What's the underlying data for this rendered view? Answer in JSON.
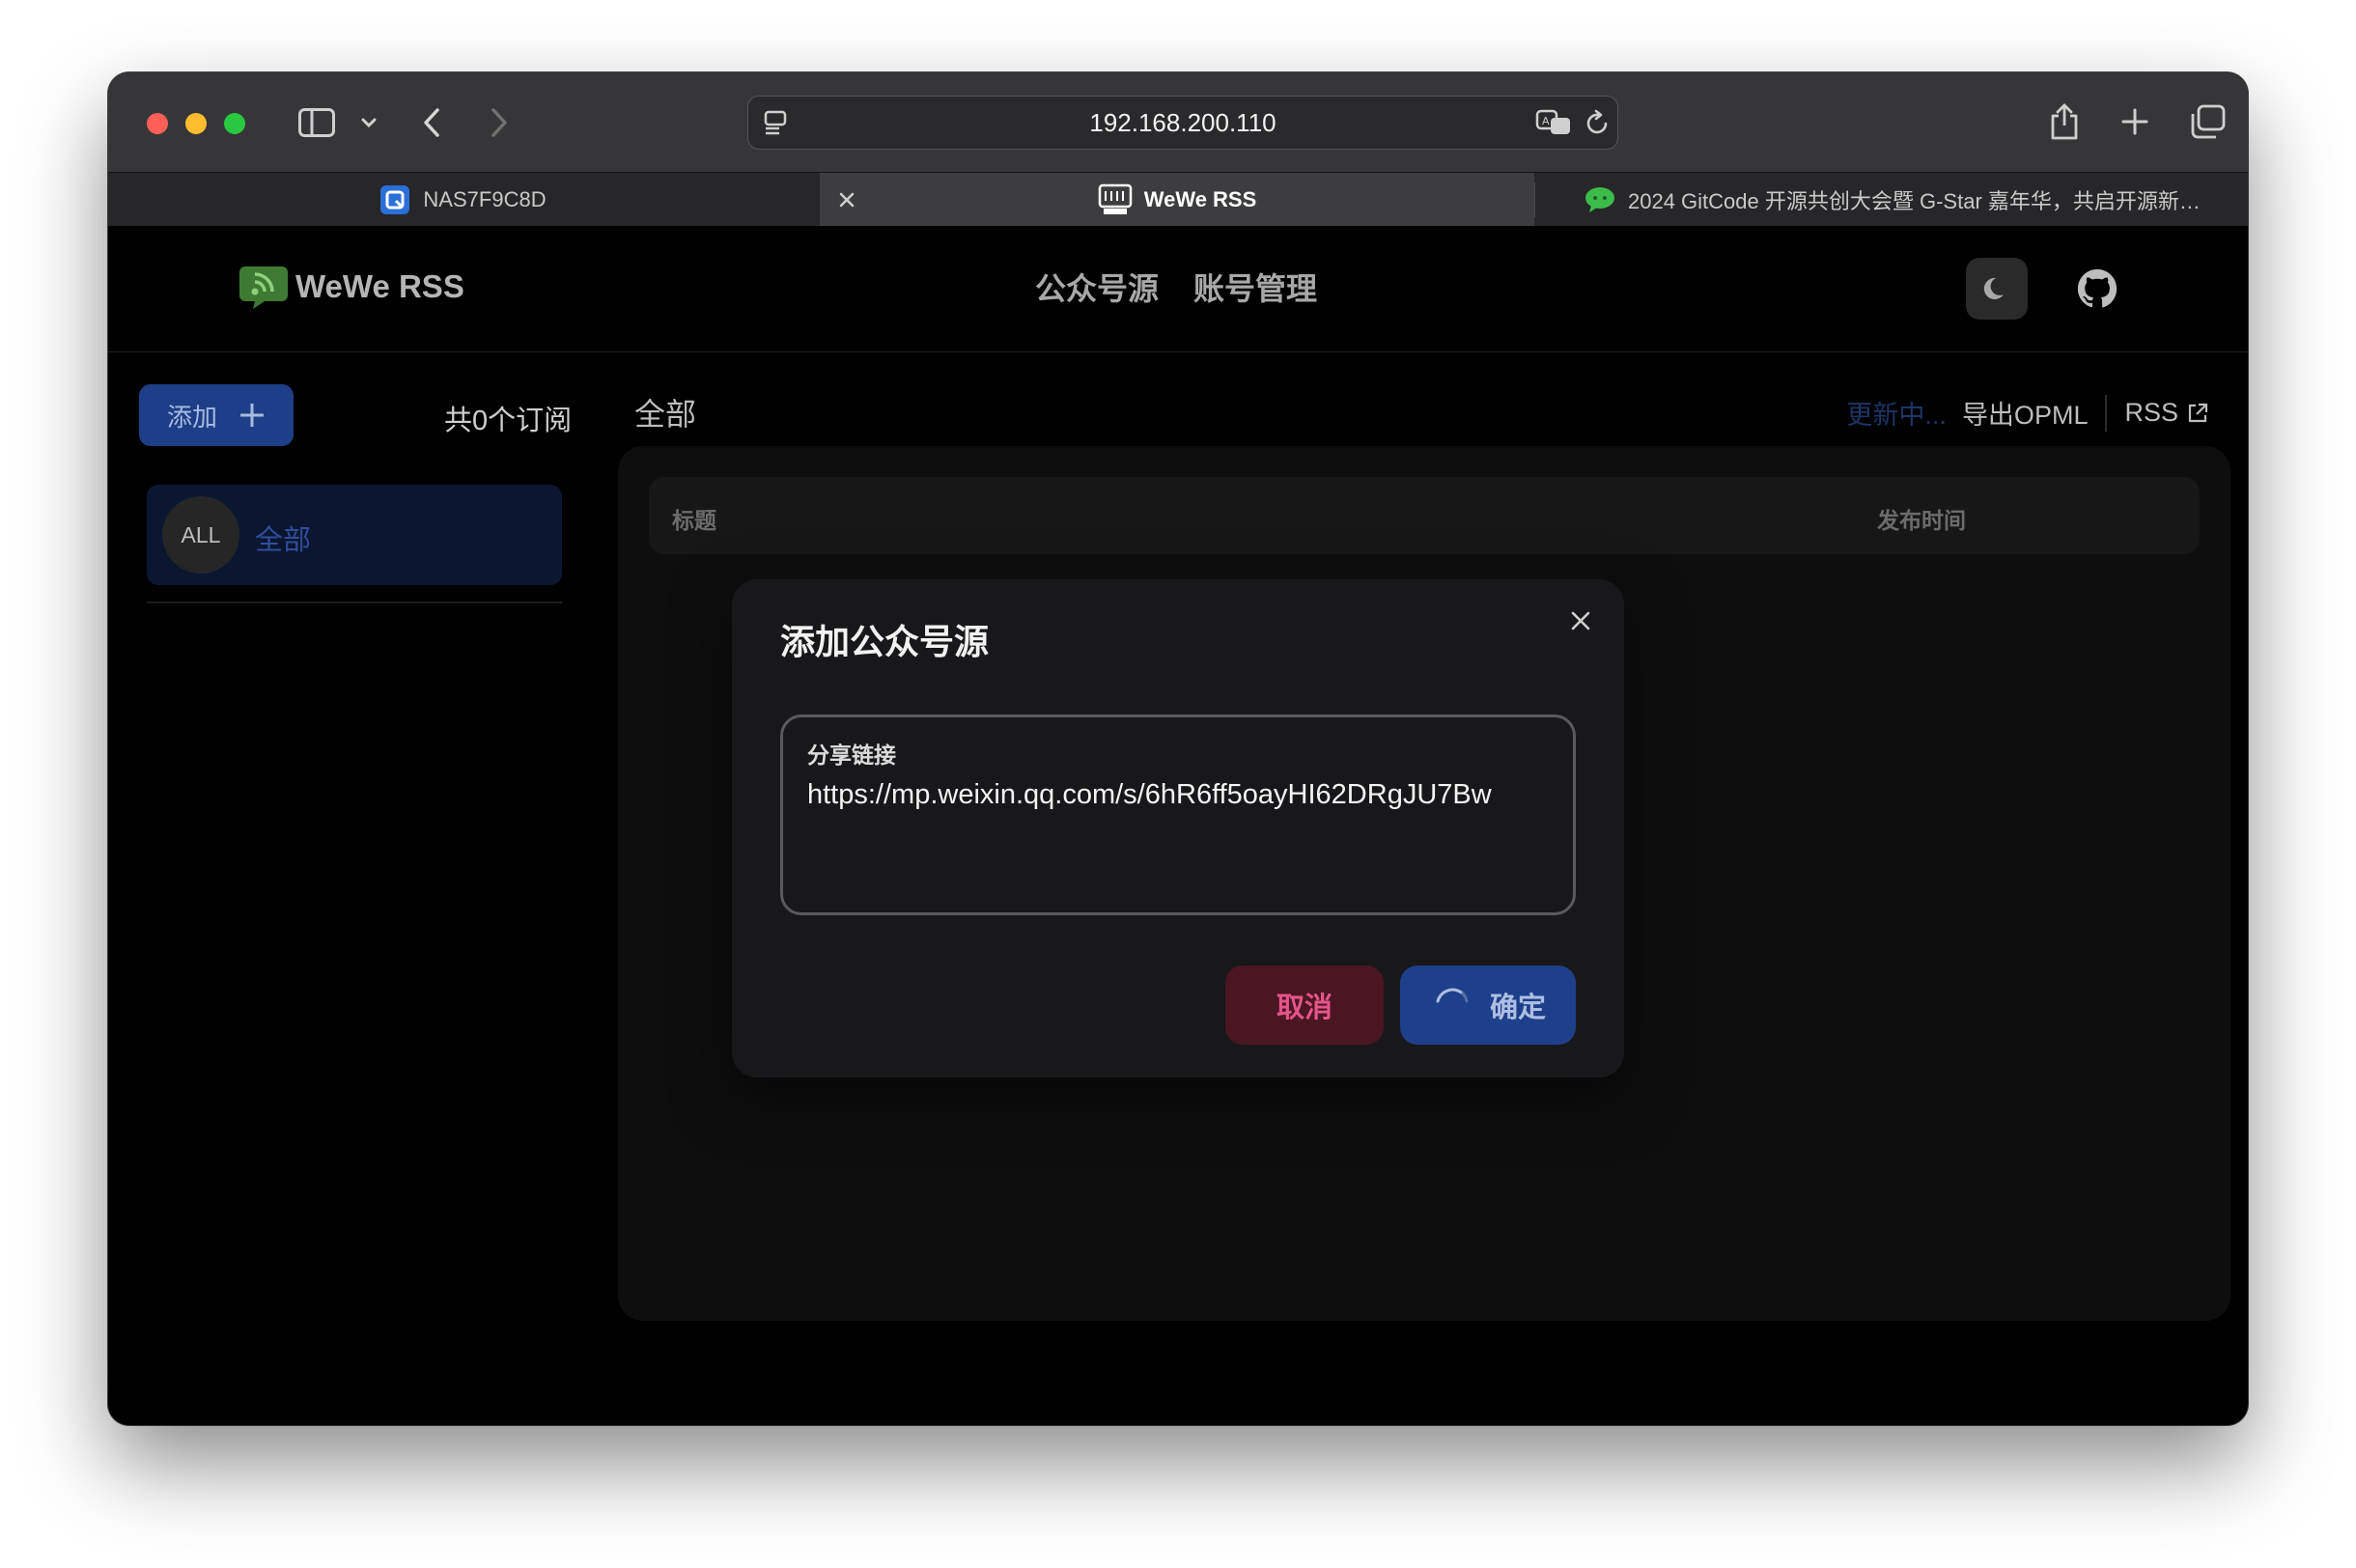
{
  "browser": {
    "address": "192.168.200.110",
    "tabs": [
      {
        "label": "NAS7F9C8D",
        "active": false
      },
      {
        "label": "WeWe RSS",
        "active": true
      },
      {
        "label": "2024 GitCode 开源共创大会暨 G-Star 嘉年华，共启开源新…",
        "active": false
      }
    ]
  },
  "app": {
    "brand": "WeWe RSS",
    "nav": [
      "公众号源",
      "账号管理"
    ],
    "sidebar": {
      "add_label": "添加",
      "count_text": "共0个订阅",
      "items": [
        {
          "avatar": "ALL",
          "label": "全部"
        }
      ]
    },
    "main": {
      "title": "全部",
      "updating": "更新中...",
      "export_label": "导出OPML",
      "rss_label": "RSS",
      "columns": [
        "标题",
        "发布时间"
      ]
    }
  },
  "modal": {
    "title": "添加公众号源",
    "field_label": "分享链接",
    "field_value": "https://mp.weixin.qq.com/s/6hR6ff5oayHI62DRgJU7Bw",
    "cancel_label": "取消",
    "confirm_label": "确定",
    "confirm_loading": true
  },
  "colors": {
    "accent": "#1e3f8a",
    "danger": "#e5548a",
    "brand_green": "#4caf3f"
  }
}
